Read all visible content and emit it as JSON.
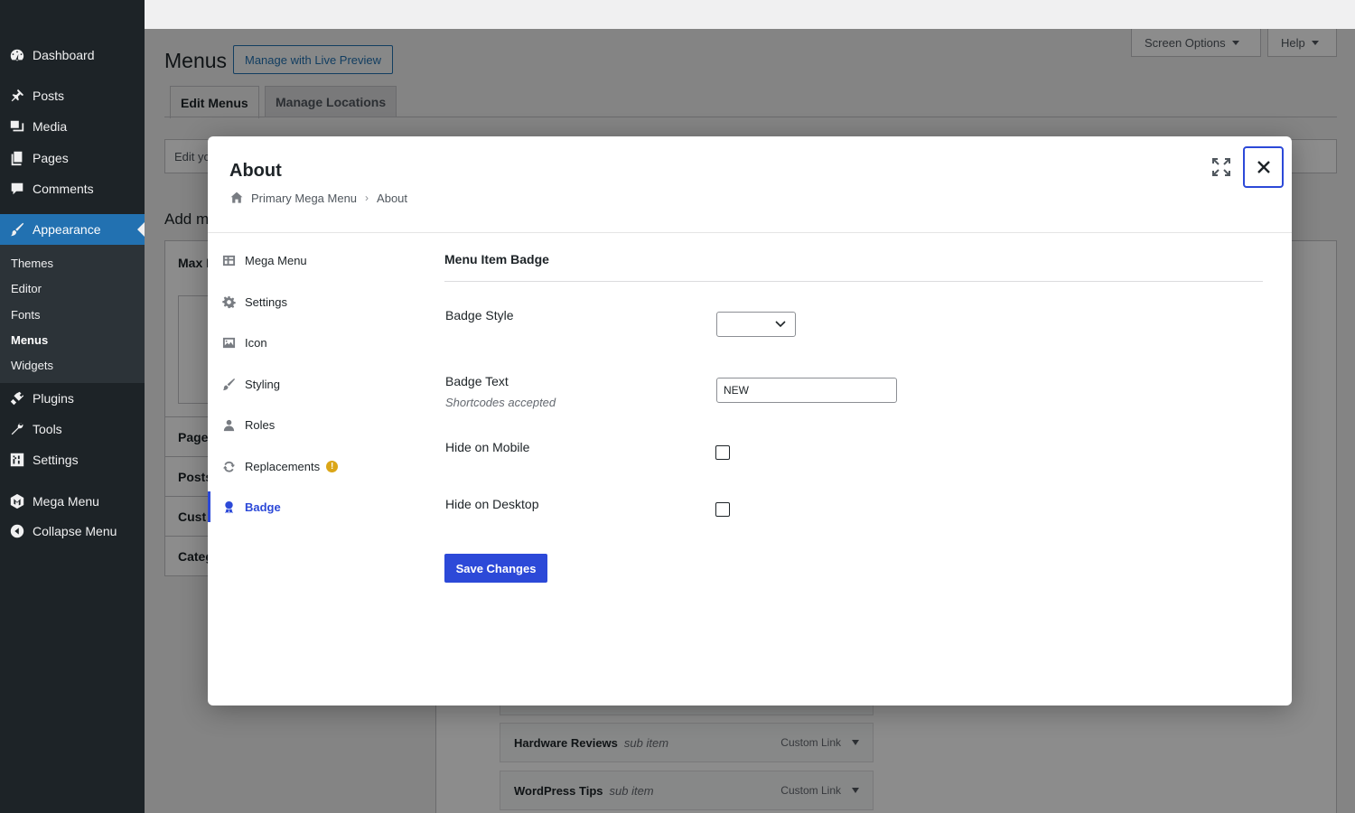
{
  "sidebar": {
    "items": [
      {
        "label": "Dashboard",
        "icon": "dashboard-icon"
      },
      {
        "label": "Posts",
        "icon": "pin-icon"
      },
      {
        "label": "Media",
        "icon": "media-icon"
      },
      {
        "label": "Pages",
        "icon": "pages-icon"
      },
      {
        "label": "Comments",
        "icon": "comment-icon"
      },
      {
        "label": "Appearance",
        "icon": "paintbrush-icon"
      },
      {
        "label": "Plugins",
        "icon": "plugin-icon"
      },
      {
        "label": "Tools",
        "icon": "wrench-icon"
      },
      {
        "label": "Settings",
        "icon": "sliders-icon"
      },
      {
        "label": "Mega Menu",
        "icon": "mega-menu-icon"
      },
      {
        "label": "Collapse Menu",
        "icon": "collapse-icon"
      }
    ],
    "submenu": [
      "Themes",
      "Editor",
      "Fonts",
      "Menus",
      "Widgets"
    ],
    "active_submenu": "Menus"
  },
  "header": {
    "screen_options": "Screen Options",
    "help": "Help"
  },
  "page": {
    "title": "Menus",
    "live_preview": "Manage with Live Preview",
    "tabs": [
      "Edit Menus",
      "Manage Locations"
    ],
    "bg_fragments": {
      "edit_partial": "Edit yo",
      "add_partial": "Add m",
      "max_partial": "Max M",
      "pages_partial": "Page",
      "posts_partial": "Posts",
      "custom_partial": "Cust",
      "categories_partial": "Categ"
    },
    "menu_items": [
      {
        "title": "Hardware Reviews",
        "sub": "sub item",
        "type": "Custom Link"
      },
      {
        "title": "WordPress Tips",
        "sub": "sub item",
        "type": "Custom Link"
      }
    ]
  },
  "modal": {
    "title": "About",
    "breadcrumb": [
      "Primary Mega Menu",
      "About"
    ],
    "tabs": [
      {
        "label": "Mega Menu",
        "icon": "grid-icon"
      },
      {
        "label": "Settings",
        "icon": "gear-icon"
      },
      {
        "label": "Icon",
        "icon": "image-icon"
      },
      {
        "label": "Styling",
        "icon": "brush-icon"
      },
      {
        "label": "Roles",
        "icon": "user-icon"
      },
      {
        "label": "Replacements",
        "icon": "refresh-icon",
        "warning": "!"
      },
      {
        "label": "Badge",
        "icon": "award-icon"
      }
    ],
    "active_tab": "Badge",
    "section_title": "Menu Item Badge",
    "fields": {
      "badge_style_label": "Badge Style",
      "badge_style_value": "",
      "badge_text_label": "Badge Text",
      "badge_text_desc": "Shortcodes accepted",
      "badge_text_value": "NEW",
      "hide_mobile_label": "Hide on Mobile",
      "hide_mobile_checked": false,
      "hide_desktop_label": "Hide on Desktop",
      "hide_desktop_checked": false
    },
    "save_label": "Save Changes",
    "close_symbol": "✕"
  },
  "colors": {
    "sidebar_bg": "#1d2327",
    "wp_blue": "#2271b1",
    "accent": "#2c49d8",
    "warning": "#dba617"
  }
}
